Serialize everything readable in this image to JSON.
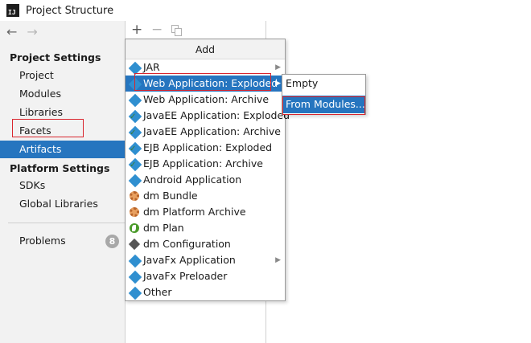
{
  "window": {
    "title": "Project Structure",
    "app_icon_text": "IJ"
  },
  "nav": {
    "back": "←",
    "forward": "→"
  },
  "sidebar": {
    "project_settings_header": "Project Settings",
    "project_settings_items": [
      "Project",
      "Modules",
      "Libraries",
      "Facets",
      "Artifacts"
    ],
    "platform_settings_header": "Platform Settings",
    "platform_settings_items": [
      "SDKs",
      "Global Libraries"
    ],
    "problems_label": "Problems",
    "problems_count": "8",
    "selected": "Artifacts"
  },
  "toolbar": {
    "add": "+",
    "remove": "−"
  },
  "add_menu": {
    "header": "Add",
    "items": [
      {
        "label": "JAR",
        "icon": "artifact-icon",
        "has_submenu": true
      },
      {
        "label": "Web Application: Exploded",
        "icon": "artifact-icon",
        "has_submenu": true,
        "selected": true
      },
      {
        "label": "Web Application: Archive",
        "icon": "artifact-icon"
      },
      {
        "label": "JavaEE Application: Exploded",
        "icon": "artifact-check-icon"
      },
      {
        "label": "JavaEE Application: Archive",
        "icon": "artifact-check-icon"
      },
      {
        "label": "EJB Application: Exploded",
        "icon": "artifact-check-icon"
      },
      {
        "label": "EJB Application: Archive",
        "icon": "artifact-check-icon"
      },
      {
        "label": "Android Application",
        "icon": "artifact-icon"
      },
      {
        "label": "dm Bundle",
        "icon": "gear-icon"
      },
      {
        "label": "dm Platform Archive",
        "icon": "gear-icon"
      },
      {
        "label": "dm Plan",
        "icon": "leaf-icon"
      },
      {
        "label": "dm Configuration",
        "icon": "cube-icon"
      },
      {
        "label": "JavaFx Application",
        "icon": "artifact-icon",
        "has_submenu": true
      },
      {
        "label": "JavaFx Preloader",
        "icon": "artifact-icon"
      },
      {
        "label": "Other",
        "icon": "artifact-icon"
      }
    ]
  },
  "submenu": {
    "items": [
      "Empty",
      "From Modules..."
    ],
    "selected": "From Modules..."
  },
  "colors": {
    "selection": "#2675bf",
    "highlight_box": "#d9262e"
  }
}
